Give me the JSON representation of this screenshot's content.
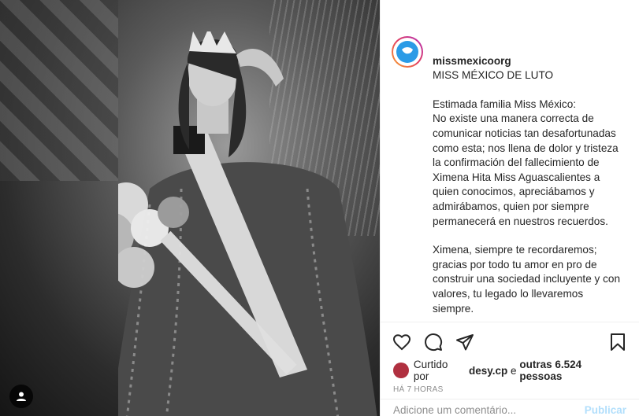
{
  "post": {
    "username": "missmexicoorg",
    "caption_heading": "MISS MÉXICO DE LUTO",
    "paragraph1": "Estimada familia Miss México:\nNo existe una manera correcta de comunicar noticias tan desafortunadas como esta; nos llena de dolor y tristeza la confirmación del fallecimiento de Ximena Hita Miss Aguascalientes a quien conocimos, apreciábamos y admirábamos, quien por siempre permanecerá en nuestros recuerdos.",
    "paragraph2": "Ximena, siempre te recordaremos; gracias por todo tu amor en pro de construir una sociedad incluyente y con valores, tu legado lo llevaremos siempre.",
    "liked_prefix": "Curtido por",
    "liked_user": "desy.cp",
    "liked_join": "e",
    "liked_others": "outras 6.524 pessoas",
    "time": "HÁ 7 HORAS"
  },
  "comment": {
    "placeholder": "Adicione um comentário...",
    "post_label": "Publicar"
  },
  "icons": {
    "like": "heart-icon",
    "comment": "comment-icon",
    "share": "share-icon",
    "save": "bookmark-icon",
    "user_tag": "user-icon"
  }
}
